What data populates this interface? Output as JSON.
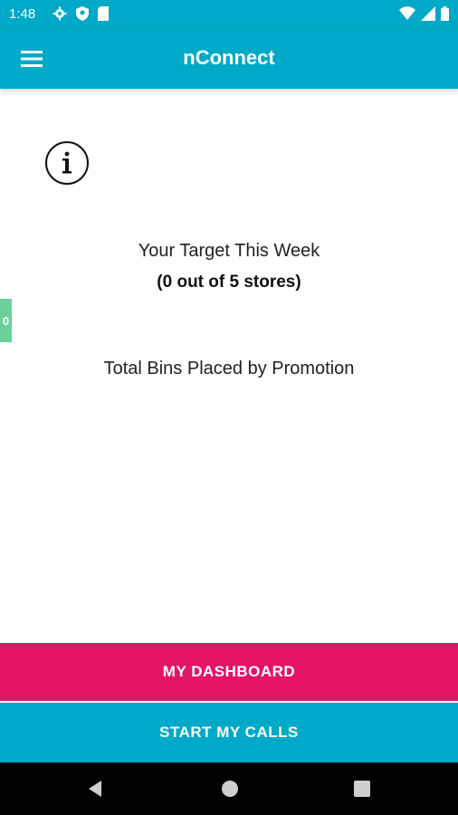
{
  "status_bar": {
    "time": "1:48",
    "icons_left": [
      "gear-icon",
      "shield-icon",
      "sd-card-icon"
    ],
    "icons_right": [
      "wifi-icon",
      "signal-icon",
      "battery-icon"
    ]
  },
  "app_bar": {
    "title": "nConnect",
    "menu_icon": "hamburger-menu-icon"
  },
  "main": {
    "info_icon": "info-icon",
    "target_title": "Your Target This Week",
    "target_count": "(0 out of 5 stores)",
    "side_tab_value": "0",
    "bins_label": "Total Bins Placed by Promotion"
  },
  "actions": {
    "dashboard_label": "MY DASHBOARD",
    "calls_label": "START MY CALLS"
  },
  "nav_bar": {
    "buttons": [
      "back-icon",
      "home-icon",
      "recents-icon"
    ]
  },
  "colors": {
    "primary": "#00a9c7",
    "accent": "#e41566",
    "side_tab": "#6ccf9a"
  }
}
